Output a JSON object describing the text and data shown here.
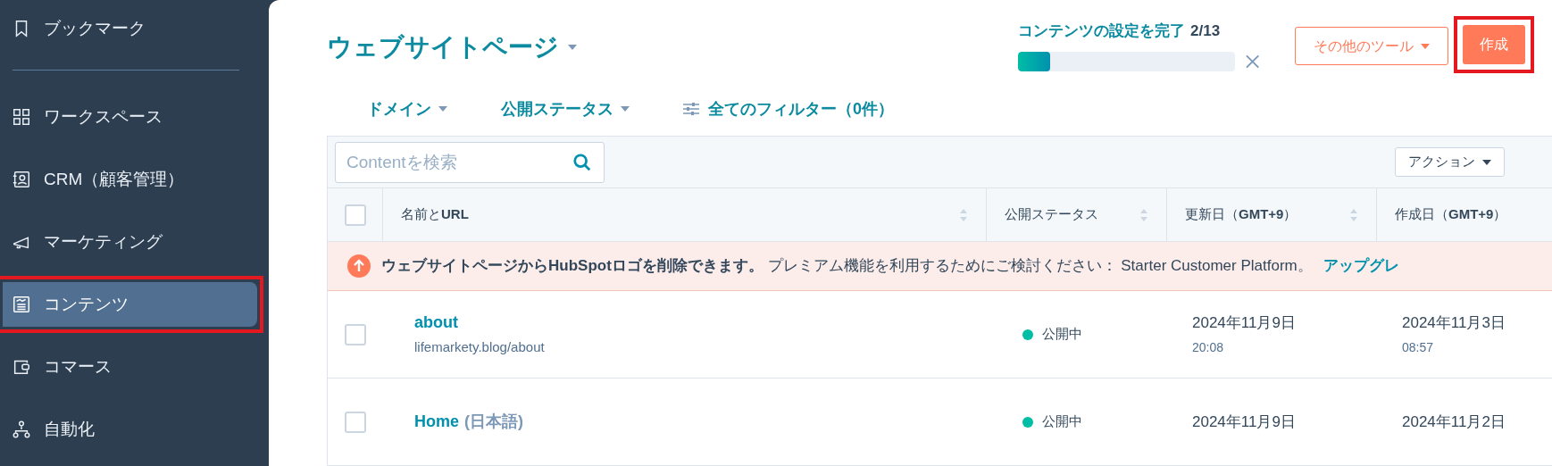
{
  "sidebar": {
    "items": [
      {
        "label": "ブックマーク",
        "selected": false,
        "highlighted": false
      },
      {
        "label": "ワークスペース",
        "selected": false,
        "highlighted": false
      },
      {
        "label": "CRM（顧客管理）",
        "selected": false,
        "highlighted": false
      },
      {
        "label": "マーケティング",
        "selected": false,
        "highlighted": false
      },
      {
        "label": "コンテンツ",
        "selected": true,
        "highlighted": true
      },
      {
        "label": "コマース",
        "selected": false,
        "highlighted": false
      },
      {
        "label": "自動化",
        "selected": false,
        "highlighted": false
      }
    ]
  },
  "header": {
    "title": "ウェブサイトページ",
    "setup": {
      "label": "コンテンツの設定を完了",
      "count": "2/13",
      "level": 0.15
    },
    "more_tools": "その他のツール",
    "create": {
      "label": "作成",
      "highlighted": true
    }
  },
  "filters": [
    {
      "kind": "dropdown",
      "label": "ドメイン"
    },
    {
      "kind": "dropdown",
      "label": "公開ステータス"
    },
    {
      "kind": "all",
      "label": "全てのフィルター（0件）"
    }
  ],
  "table": {
    "search": {
      "placeholder": "Contentを検索"
    },
    "actions": "アクション",
    "all_checked": false,
    "columns": [
      {
        "label": "名前と**URL**",
        "sortable": true
      },
      {
        "label": "公開ステータス",
        "sortable": true
      },
      {
        "label": "更新日（**GMT+9**）",
        "sortable": true
      },
      {
        "label": "作成日（**GMT+9**）",
        "sortable": false
      }
    ],
    "banner": {
      "bold": "ウェブサイトページからHubSpotロゴを削除できます。",
      "text": "プレミアム機能を利用するためにご検討ください： Starter Customer Platform。",
      "link": "アップグレ"
    },
    "rows": [
      {
        "name": "about",
        "name_suffix": "",
        "url": "lifemarkety.blog/about",
        "status": "公開中",
        "published": true,
        "updated": "2024年11月9日",
        "updated_time": "20:08",
        "created": "2024年11月3日",
        "created_time": "08:57",
        "checked": false
      },
      {
        "name": "Home",
        "name_suffix": "(日本語)",
        "url": "",
        "status": "公開中",
        "published": true,
        "updated": "2024年11月9日",
        "updated_time": "",
        "created": "2024年11月2日",
        "created_time": "",
        "checked": false
      }
    ]
  }
}
